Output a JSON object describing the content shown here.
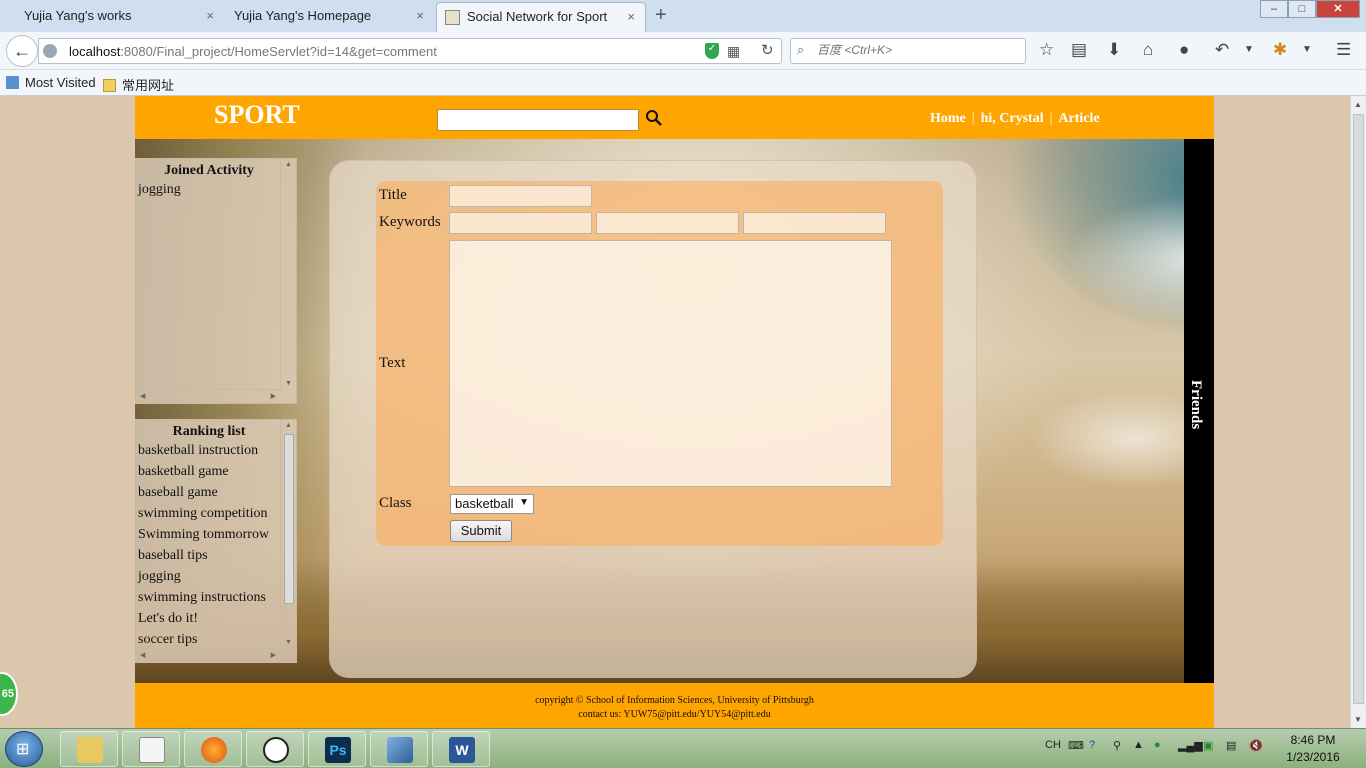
{
  "browser": {
    "tabs": [
      {
        "title": "Yujia Yang's works",
        "close": "×"
      },
      {
        "title": "Yujia Yang's Homepage",
        "close": "×"
      },
      {
        "title": "Social Network for Sport",
        "close": "×"
      }
    ],
    "new_tab": "+",
    "url_host": "localhost",
    "url_rest": ":8080/Final_project/HomeServlet?id=14&get=comment",
    "search_placeholder": "百度 <Ctrl+K>",
    "bookmarks": [
      "Most Visited",
      "常用网址"
    ],
    "window_buttons": {
      "minimize": "–",
      "maximize": "□",
      "close": "✕"
    }
  },
  "site": {
    "logo": "SPORT",
    "nav": {
      "home": "Home",
      "sep": "|",
      "user": "hi, Crystal",
      "article": "Article"
    },
    "friends_label": "Friends",
    "joined": {
      "title": "Joined Activity",
      "items": [
        "jogging"
      ]
    },
    "ranking": {
      "title": "Ranking list",
      "items": [
        "basketball instruction",
        "basketball game",
        "baseball game",
        "swimming competition",
        "Swimming tommorrow",
        "baseball tips",
        "jogging",
        "swimming instructions",
        "Let's do it!",
        "soccer tips"
      ]
    },
    "form": {
      "title_label": "Title",
      "keywords_label": "Keywords",
      "text_label": "Text",
      "class_label": "Class",
      "class_value": "basketball",
      "submit_label": "Submit"
    },
    "footer": {
      "copyright": "copyright © School of Information Sciences, University of Pittsburgh",
      "contact": "contact us: YUW75@pitt.edu/YUY54@pitt.edu"
    },
    "badge": "65"
  },
  "taskbar": {
    "apps": [
      "explorer",
      "notepad",
      "firefox",
      "qq",
      "Ps",
      "virtualbox",
      "W"
    ],
    "tray_lang": "CH",
    "time": "8:46 PM",
    "date": "1/23/2016"
  },
  "colors": {
    "accent": "#ffa500",
    "friends_bar": "#000000",
    "page_bg": "#dcc6ad"
  }
}
